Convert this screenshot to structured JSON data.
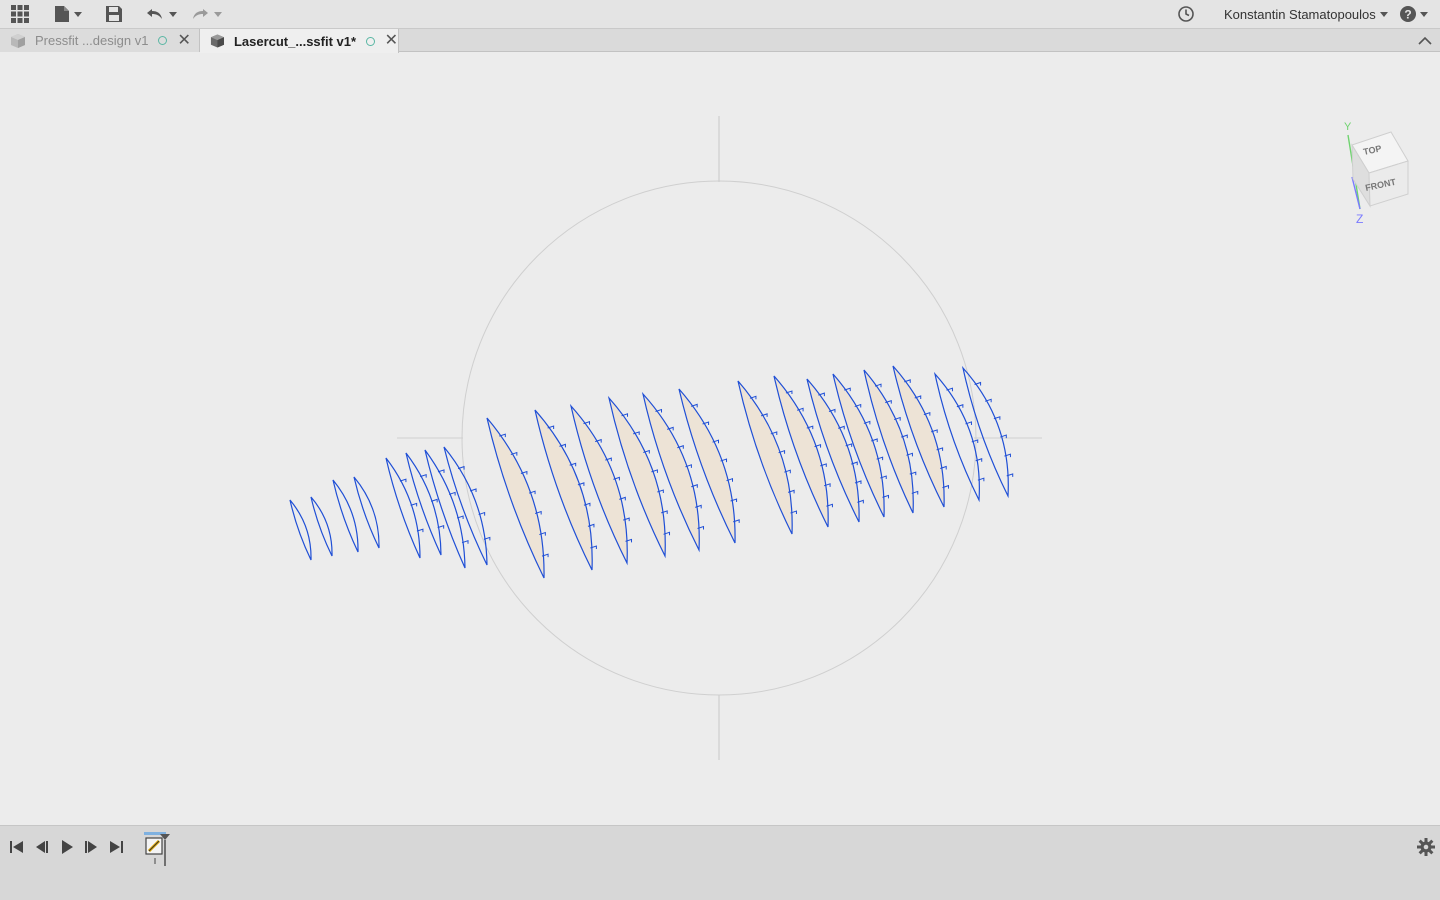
{
  "toolbar": {
    "user_name": "Konstantin Stamatopoulos",
    "icons": [
      "apps-grid-icon",
      "file-icon",
      "save-icon",
      "undo-icon",
      "redo-icon",
      "job-status-icon",
      "help-icon"
    ]
  },
  "tabs": [
    {
      "label": "Pressfit ...design v1",
      "active": false
    },
    {
      "label": "Lasercut_...ssfit v1*",
      "active": true
    }
  ],
  "viewcube": {
    "top_label": "TOP",
    "front_label": "FRONT",
    "axis_y": "Y",
    "axis_z": "Z"
  },
  "colors": {
    "sketch_profile": "#1f4fd6",
    "profile_fill": "#ede3d6",
    "accent_green": "#5bb7a4"
  }
}
